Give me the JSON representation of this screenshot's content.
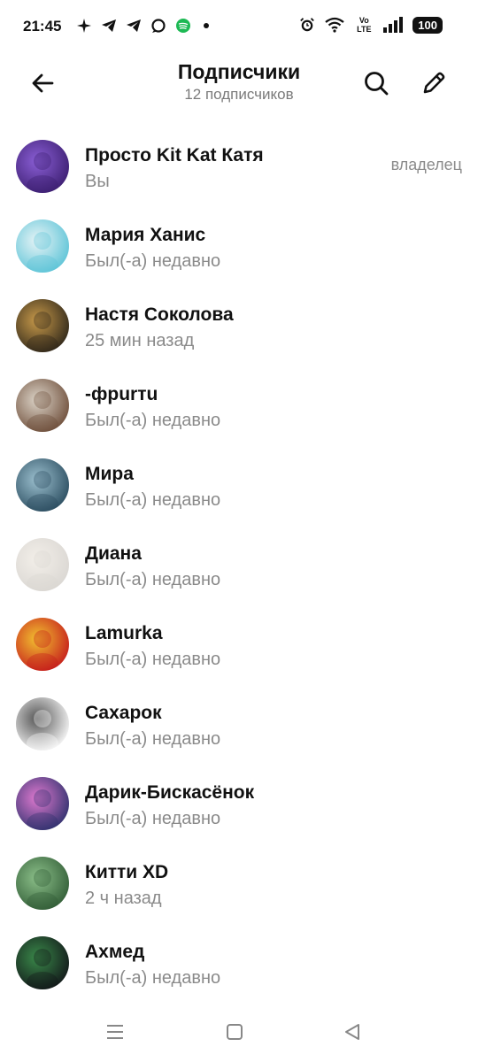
{
  "status_bar": {
    "time": "21:45",
    "battery": "100",
    "network_label": "Vo LTE"
  },
  "header": {
    "title": "Подписчики",
    "subtitle": "12 подписчиков"
  },
  "subscribers": [
    {
      "name": "Просто Kit Kat Катя",
      "status": "Вы",
      "role": "владелец",
      "avatar_colors": [
        "#3a1d6e",
        "#8b5fd6"
      ]
    },
    {
      "name": "Мария Ханис",
      "status": "Был(-а) недавно",
      "role": "",
      "avatar_colors": [
        "#58c2d6",
        "#e8f4f6"
      ]
    },
    {
      "name": "Настя Соколова",
      "status": "25 мин назад",
      "role": "",
      "avatar_colors": [
        "#2a2318",
        "#c89a4a"
      ]
    },
    {
      "name": "-фpurтu",
      "status": "Был(-а) недавно",
      "role": "",
      "avatar_colors": [
        "#6b4a36",
        "#dcd4c8"
      ]
    },
    {
      "name": "Мира",
      "status": "Был(-а) недавно",
      "role": "",
      "avatar_colors": [
        "#27495c",
        "#9cc0cf"
      ]
    },
    {
      "name": "Диана",
      "status": "Был(-а) недавно",
      "role": "",
      "avatar_colors": [
        "#d9d6d2",
        "#f3efe9"
      ]
    },
    {
      "name": "Lamurka",
      "status": "Был(-а) недавно",
      "role": "",
      "avatar_colors": [
        "#c4171b",
        "#f2c230"
      ]
    },
    {
      "name": "Сахарок",
      "status": "Был(-а) недавно",
      "role": "",
      "avatar_colors": [
        "#ffffff",
        "#555555"
      ]
    },
    {
      "name": "Дарик-Бискасёнок",
      "status": "Был(-а) недавно",
      "role": "",
      "avatar_colors": [
        "#2a2f6b",
        "#e07ad0"
      ]
    },
    {
      "name": "Китти XD",
      "status": "2 ч назад",
      "role": "",
      "avatar_colors": [
        "#2f5a34",
        "#8cc08a"
      ]
    },
    {
      "name": "Ахмед",
      "status": "Был(-а) недавно",
      "role": "",
      "avatar_colors": [
        "#111418",
        "#3a8a4a"
      ]
    }
  ],
  "icons": {
    "back": "arrow-left-icon",
    "search": "search-icon",
    "edit": "pencil-icon"
  }
}
